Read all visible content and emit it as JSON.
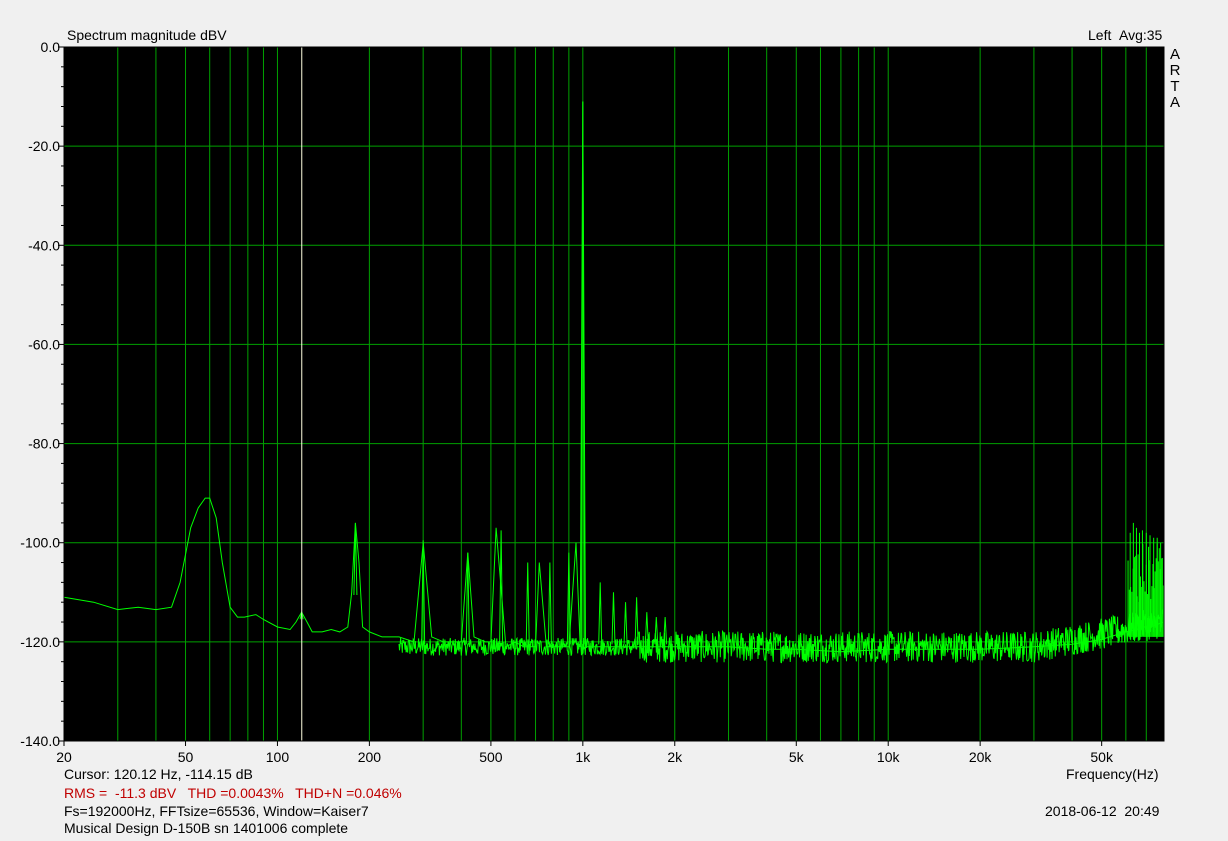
{
  "header": {
    "title": "Spectrum magnitude dBV",
    "channel": "Left",
    "avg": "Avg:35",
    "logo_letters": [
      "A",
      "R",
      "T",
      "A"
    ]
  },
  "footer": {
    "cursor": "Cursor: 120.12 Hz, -114.15 dB",
    "measurements": "RMS =  -11.3 dBV   THD =0.0043%   THD+N =0.046%",
    "params": "Fs=192000Hz, FFTsize=65536, Window=Kaiser7",
    "device": "Musical Design D-150B sn 1401006 complete",
    "datetime": "2018-06-12  20:49",
    "xlabel": "Frequency(Hz)"
  },
  "colors": {
    "background": "#f0f0f0",
    "plot_bg": "#000000",
    "grid": "#00a000",
    "trace": "#00ff00",
    "cursor": "#ffffe0",
    "stats_text": "#c00000"
  },
  "chart_data": {
    "type": "line",
    "title": "Spectrum magnitude dBV",
    "xlabel": "Frequency(Hz)",
    "ylabel": "",
    "x_scale": "log",
    "xlim": [
      20,
      80000
    ],
    "ylim": [
      -140,
      0
    ],
    "grid": true,
    "y_ticks": [
      0,
      -20,
      -40,
      -60,
      -80,
      -100,
      -120,
      -140
    ],
    "y_tick_labels": [
      "0.0",
      "-20.0",
      "-40.0",
      "-60.0",
      "-80.0",
      "-100.0",
      "-120.0",
      "-140.0"
    ],
    "x_ticks": [
      20,
      50,
      100,
      200,
      500,
      1000,
      2000,
      5000,
      10000,
      20000,
      50000
    ],
    "x_tick_labels": [
      "20",
      "50",
      "100",
      "200",
      "500",
      "1k",
      "2k",
      "5k",
      "10k",
      "20k",
      "50k"
    ],
    "cursor_x": 120.12,
    "series": [
      {
        "x": [
          20,
          25,
          30,
          35,
          40,
          45,
          48,
          52,
          55,
          58,
          60,
          63,
          66,
          70,
          74,
          78,
          85,
          90,
          100,
          110,
          115,
          120,
          125,
          130,
          140,
          150,
          160,
          170,
          175,
          180,
          185,
          190,
          200,
          220,
          250,
          280,
          300,
          320,
          350,
          400,
          420,
          440,
          480,
          500,
          520,
          560,
          600,
          640,
          700,
          720,
          760,
          800,
          900,
          950,
          980,
          1000,
          1020,
          1050,
          1100,
          1200,
          1400,
          1600,
          1800,
          2000,
          2500,
          3000,
          4000,
          5000,
          7000,
          10000,
          15000,
          20000,
          30000,
          40000,
          50000,
          60000,
          65000,
          68000,
          72000,
          76000,
          80000
        ],
        "values": [
          -111,
          -112,
          -113.5,
          -113,
          -113.5,
          -113,
          -108,
          -97,
          -93,
          -91,
          -91,
          -95,
          -104,
          -113,
          -115,
          -115,
          -114.5,
          -115.5,
          -117,
          -117.5,
          -116,
          -114,
          -116,
          -118,
          -118,
          -117.5,
          -118,
          -117,
          -110,
          -96,
          -104,
          -117,
          -118,
          -119,
          -119,
          -120,
          -100,
          -119,
          -120,
          -120,
          -102,
          -119,
          -120,
          -120,
          -97,
          -121,
          -120,
          -121,
          -121,
          -104,
          -121,
          -121,
          -121,
          -100,
          -121,
          -11,
          -121,
          -121,
          -121,
          -121,
          -121,
          -121,
          -121,
          -121,
          -121,
          -121,
          -121.5,
          -121.5,
          -122,
          -121.5,
          -121.5,
          -121.5,
          -121,
          -120.5,
          -119.5,
          -118,
          -117.5,
          -117,
          -117,
          -116.5,
          -116
        ]
      }
    ],
    "harmonic_peaks": [
      {
        "x": 60,
        "y": -91
      },
      {
        "x": 120,
        "y": -114
      },
      {
        "x": 180,
        "y": -96
      },
      {
        "x": 300,
        "y": -99.5
      },
      {
        "x": 420,
        "y": -102
      },
      {
        "x": 540,
        "y": -97.5
      },
      {
        "x": 660,
        "y": -104
      },
      {
        "x": 780,
        "y": -104
      },
      {
        "x": 900,
        "y": -102
      },
      {
        "x": 1000,
        "y": -11
      },
      {
        "x": 1140,
        "y": -108
      },
      {
        "x": 1260,
        "y": -110
      },
      {
        "x": 1380,
        "y": -112
      },
      {
        "x": 1500,
        "y": -111
      },
      {
        "x": 1620,
        "y": -114
      },
      {
        "x": 1740,
        "y": -115
      },
      {
        "x": 1860,
        "y": -115
      }
    ],
    "ultrasonic_spurs": [
      {
        "x": 62000,
        "y": -98
      },
      {
        "x": 63500,
        "y": -96
      },
      {
        "x": 65000,
        "y": -97
      },
      {
        "x": 66500,
        "y": -98
      },
      {
        "x": 68000,
        "y": -97.5
      },
      {
        "x": 70000,
        "y": -98
      },
      {
        "x": 72000,
        "y": -98.5
      },
      {
        "x": 74000,
        "y": -99
      },
      {
        "x": 76000,
        "y": -99
      },
      {
        "x": 78000,
        "y": -100
      }
    ]
  }
}
